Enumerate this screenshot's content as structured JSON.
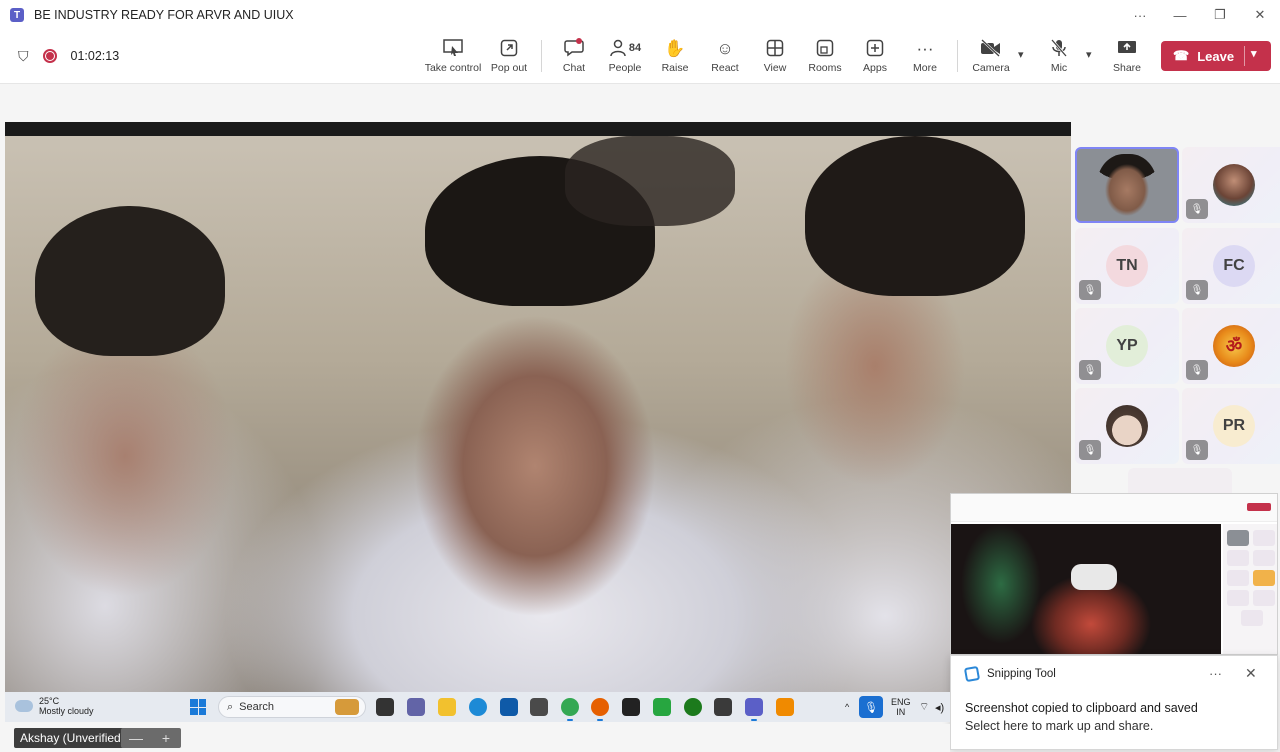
{
  "window": {
    "title": "BE INDUSTRY READY FOR ARVR AND UIUX",
    "controls": {
      "more": "···",
      "minimize": "—",
      "restore": "❐",
      "close": "✕"
    }
  },
  "meeting": {
    "timer": "01:02:13",
    "people_count": "84",
    "toolbar": {
      "take_control": "Take control",
      "pop_out": "Pop out",
      "chat": "Chat",
      "people": "People",
      "raise": "Raise",
      "react": "React",
      "view": "View",
      "rooms": "Rooms",
      "apps": "Apps",
      "more": "More",
      "camera": "Camera",
      "mic": "Mic",
      "share": "Share",
      "leave": "Leave"
    }
  },
  "participants": [
    {
      "type": "video",
      "muted": false
    },
    {
      "type": "photo",
      "muted": true
    },
    {
      "initials": "TN",
      "color": "#f3d9de",
      "muted": true
    },
    {
      "initials": "FC",
      "color": "#dcd9f3",
      "muted": true
    },
    {
      "initials": "YP",
      "color": "#e2eed9",
      "muted": true
    },
    {
      "type": "emblem",
      "muted": true
    },
    {
      "type": "cartoon",
      "muted": true
    },
    {
      "initials": "PR",
      "color": "#f8ecd0",
      "muted": true
    }
  ],
  "toast": {
    "app": "Snipping Tool",
    "line1": "Screenshot copied to clipboard and saved",
    "line2": "Select here to mark up and share."
  },
  "taskbar": {
    "temperature": "25°C",
    "condition": "Mostly cloudy",
    "search_placeholder": "Search",
    "language": "ENG",
    "region": "IN"
  },
  "name_tag": "Akshay (Unverified)",
  "zoom": {
    "minus": "—",
    "plus": "+"
  },
  "colors": {
    "leave": "#c4314b",
    "accent": "#5b5fc7",
    "active_border": "#7f85f5"
  }
}
